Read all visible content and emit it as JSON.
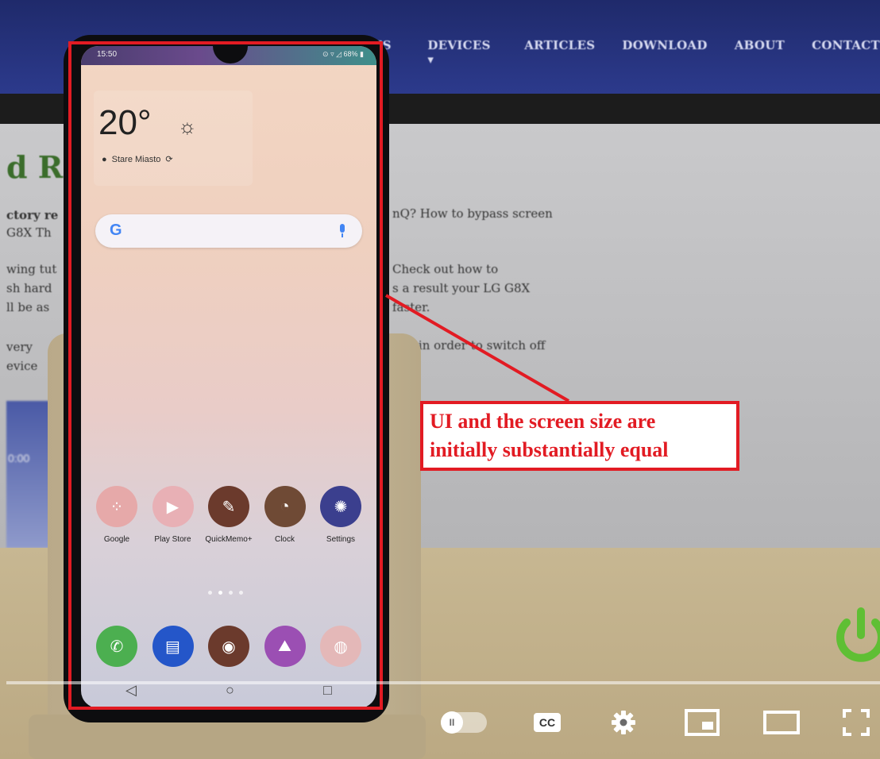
{
  "website": {
    "nav_items": [
      "ES ▾",
      "DEVICES ▾",
      "ARTICLES",
      "DOWNLOAD",
      "ABOUT",
      "CONTACT"
    ],
    "heading_fragment": "d Re",
    "lines": [
      "ctory re",
      "G8X Th",
      "wing tut",
      "sh hard",
      "ll be as",
      "very",
      "evice",
      "nQ? How to bypass screen",
      "Check out how to",
      "s a result your LG G8X",
      "faster.",
      "hile in order to switch off"
    ],
    "thumb_text": "0:00"
  },
  "phone": {
    "status_time": "15:50",
    "status_icons": "⊙ ▿ ◿ 68% ▮",
    "weather": {
      "temperature": "20°",
      "sun_icon": "☼",
      "location": "Stare Miasto",
      "refresh_icon": "⟳"
    },
    "search": {
      "logo": "G"
    },
    "apps_row": [
      {
        "label": "Google",
        "color": "#e6a9a9",
        "icon": "grid-icon"
      },
      {
        "label": "Play Store",
        "color": "#e8b0b5",
        "icon": "play-icon"
      },
      {
        "label": "QuickMemo+",
        "color": "#6b3a2c",
        "icon": "pencil-icon"
      },
      {
        "label": "Clock",
        "color": "#6f4a35",
        "icon": "clock-icon"
      },
      {
        "label": "Settings",
        "color": "#3b3f8e",
        "icon": "gear-icon"
      }
    ],
    "dock": [
      {
        "name": "phone",
        "color": "#4caf50",
        "glyph": "✆"
      },
      {
        "name": "messages",
        "color": "#2456c9",
        "glyph": "▤"
      },
      {
        "name": "camera",
        "color": "#6b3a2c",
        "glyph": "◉"
      },
      {
        "name": "gallery",
        "color": "#9b4fb3",
        "glyph": "⛰"
      },
      {
        "name": "chrome",
        "color": "#e4b8b8",
        "glyph": "◍"
      }
    ],
    "nav": {
      "back": "◁",
      "home": "○",
      "recents": "□"
    }
  },
  "annotation": {
    "text_line1": "UI and the screen size are",
    "text_line2": "initially substantially equal",
    "color": "#e21b23"
  },
  "player": {
    "autoplay_glyph": "II",
    "cc_label": "CC"
  }
}
